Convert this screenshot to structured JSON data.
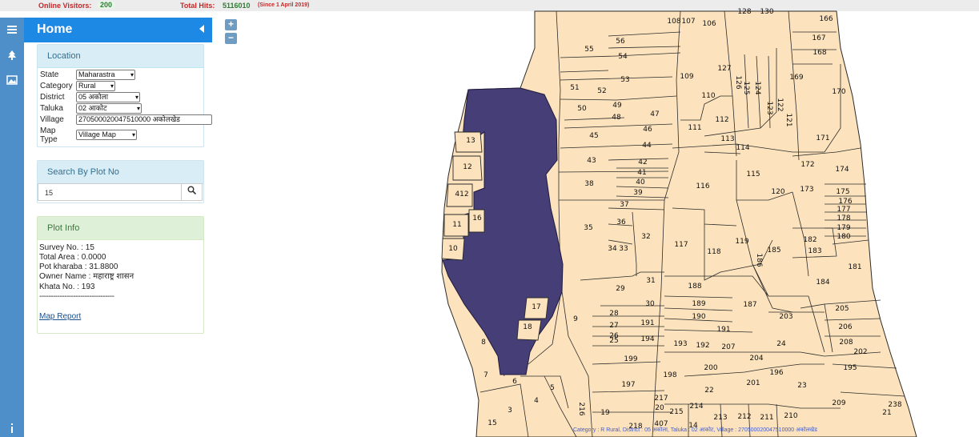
{
  "topbar": {
    "visitors_label": "Online Visitors:",
    "visitors_value": "200",
    "hits_label": "Total Hits:",
    "hits_value": "5116010",
    "hits_since": "(Since 1 April 2019)"
  },
  "rail": {
    "icons": [
      "menu-icon",
      "tree-icon",
      "image-icon",
      "info-icon"
    ]
  },
  "header": {
    "title": "Home"
  },
  "location": {
    "heading": "Location",
    "state_label": "State",
    "state_value": "Maharastra",
    "category_label": "Category",
    "category_value": "Rural",
    "district_label": "District",
    "district_value": "05 अकोला",
    "taluka_label": "Taluka",
    "taluka_value": "02 आकोट",
    "village_label": "Village",
    "village_value": "270500020047510000 अकोलखेड",
    "maptype_label_1": "Map",
    "maptype_label_2": "Type",
    "maptype_value": "Village Map"
  },
  "search": {
    "heading": "Search By Plot No",
    "value": "15"
  },
  "plot_info": {
    "heading": "Plot Info",
    "survey": "Survey No. : 15",
    "area": "Total Area : 0.0000",
    "kharaba": "Pot kharaba : 31.8800",
    "owner": "Owner Name : महाराष्ट्र शासन",
    "khata": "Khata No. : 193",
    "divider": "---------------------------------",
    "report_link": "Map Report"
  },
  "zoom": {
    "in": "+",
    "out": "−"
  },
  "map": {
    "colors": {
      "parcel_fill": "#fde3bd",
      "parcel_stroke": "#2b2b2b",
      "selected_fill": "#463e76"
    },
    "selected_plot": "15",
    "plot_labels": [
      "128",
      "130",
      "166",
      "108",
      "107",
      "106",
      "56",
      "167",
      "55",
      "54",
      "168",
      "53",
      "127",
      "109",
      "51",
      "52",
      "126",
      "125",
      "124",
      "123",
      "122",
      "121",
      "169",
      "110",
      "170",
      "50",
      "49",
      "47",
      "48",
      "112",
      "46",
      "111",
      "113",
      "171",
      "45",
      "44",
      "114",
      "43",
      "42",
      "172",
      "174",
      "41",
      "115",
      "40",
      "38",
      "116",
      "120",
      "173",
      "175",
      "39",
      "176",
      "177",
      "37",
      "178",
      "179",
      "180",
      "36",
      "35",
      "32",
      "117",
      "119",
      "182",
      "183",
      "34",
      "33",
      "118",
      "186",
      "185",
      "181",
      "31",
      "184",
      "29",
      "188",
      "30",
      "189",
      "187",
      "205",
      "28",
      "190",
      "203",
      "191",
      "27",
      "191",
      "206",
      "26",
      "25",
      "194",
      "193",
      "192",
      "207",
      "208",
      "202",
      "24",
      "199",
      "204",
      "195",
      "200",
      "196",
      "198",
      "201",
      "23",
      "197",
      "22",
      "20",
      "19",
      "216",
      "217",
      "215",
      "214",
      "213",
      "212",
      "211",
      "210",
      "209",
      "238",
      "21",
      "218",
      "407",
      "14",
      "13",
      "12",
      "412",
      "11",
      "10",
      "16",
      "17",
      "18",
      "9",
      "8",
      "7",
      "6",
      "5",
      "4",
      "3",
      "15"
    ],
    "status_text": "Category : R Rural, District : 05 अकोला, Taluka : 02 आकोट, Village : 270500020047510000 अकोलखेड"
  }
}
